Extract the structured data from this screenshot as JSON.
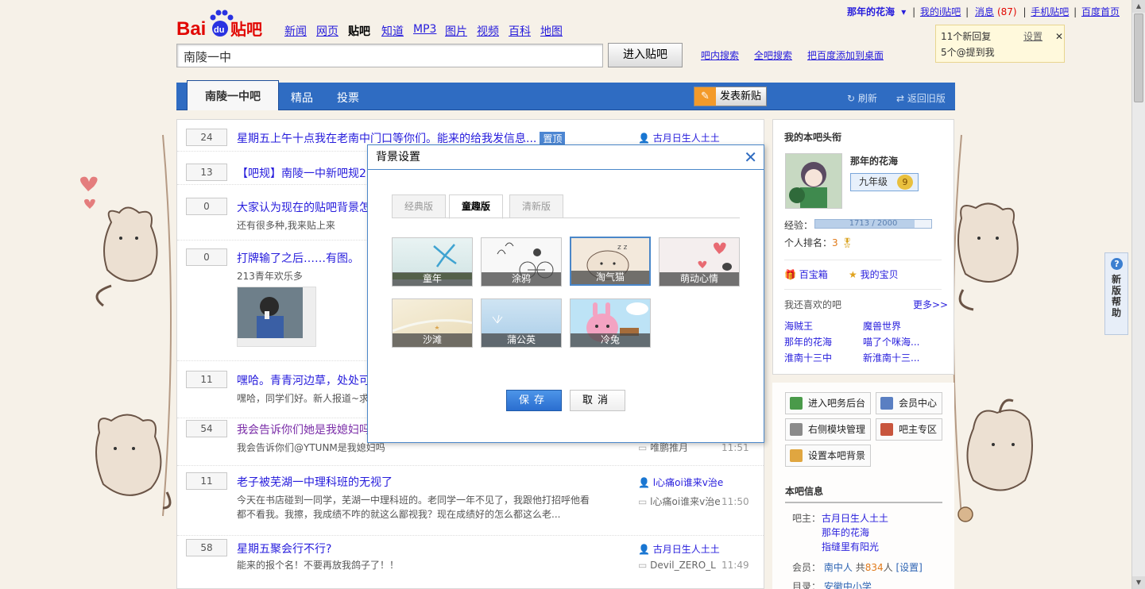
{
  "header": {
    "nav": [
      "新闻",
      "网页",
      "贴吧",
      "知道",
      "MP3",
      "图片",
      "视频",
      "百科",
      "地图"
    ],
    "active_nav": "贴吧",
    "search_value": "南陵一中",
    "enter_button": "进入贴吧",
    "links": [
      "吧内搜索",
      "全吧搜索",
      "把百度添加到桌面"
    ]
  },
  "userbar": {
    "username": "那年的花海",
    "my_i": "我的i贴吧",
    "messages_label": "消息",
    "messages_count": "(87)",
    "mobile": "手机贴吧",
    "home": "百度首页"
  },
  "notif": {
    "line1": "11个新回复",
    "setting": "设置",
    "line2": "5个@提到我"
  },
  "tabbar": {
    "main_tab": "南陵一中吧",
    "tabs": [
      "精品",
      "投票"
    ],
    "post_button": "发表新贴",
    "refresh": "刷新",
    "old_version": "返回旧版"
  },
  "threads": [
    {
      "count": "24",
      "title": "星期五上午十点我在老南中门口等你们。能来的给我发信息...",
      "badge": "置顶",
      "author": "古月日生人土土"
    },
    {
      "count": "13",
      "title": "【吧规】南陵一中新吧规2("
    },
    {
      "count": "0",
      "title": "大家认为现在的贴吧背景怎",
      "abstract": "还有很多种,我来贴上来"
    },
    {
      "count": "0",
      "title": "打牌输了之后……有图。",
      "abstract": "213青年欢乐多"
    },
    {
      "count": "11",
      "title": "嘿哈。青青河边草，处处可",
      "abstract": "嘿哈，同学们好。新人报道~求"
    },
    {
      "count": "54",
      "title": "我会告诉你们她是我媳妇吗",
      "abstract": "我会告诉你们@YTUNM是我媳妇吗",
      "last": "唯鹏推月",
      "time": "11:51"
    },
    {
      "count": "11",
      "title": "老子被芜湖一中理科班的无视了",
      "abstract": "今天在书店碰到一同学，芜湖一中理科班的。老同学一年不见了，我跟他打招呼他看都不看我。我擦，我成绩不咋的就这么鄙视我？现在成绩好的怎么都这么老...",
      "author": "l心痛oi谁来v治e",
      "last": "l心痛oi谁来v治e",
      "time": "11:50"
    },
    {
      "count": "58",
      "title": "星期五聚会行不行?",
      "abstract": "能来的报个名！不要再放我鸽子了！！",
      "author": "古月日生人土土",
      "last": "Devil_ZERO_L",
      "time": "11:49"
    }
  ],
  "sidebar": {
    "title": "我的本吧头衔",
    "username": "那年的花海",
    "level_name": "九年级",
    "level_num": "9",
    "exp_label": "经验：",
    "exp_value": "1713 / 2000",
    "exp_progress": 0.8565,
    "rank_label": "个人排名：",
    "rank_value": "3",
    "treasure": "百宝箱",
    "my_treasure": "我的宝贝",
    "like_title": "我还喜欢的吧",
    "more": "更多>>",
    "liked": [
      "海贼王",
      "魔兽世界",
      "那年的花海",
      "喵了个咪海...",
      "淮南十三中",
      "新淮南十三..."
    ]
  },
  "side2": {
    "buttons": [
      "进入吧务后台",
      "会员中心",
      "右侧模块管理",
      "吧主专区",
      "设置本吧背景"
    ],
    "info_title": "本吧信息",
    "owner_label": "吧主：",
    "owners": [
      "古月日生人土土",
      "那年的花海",
      "指缝里有阳光"
    ],
    "member_label": "会员：",
    "member_name": "南中人",
    "member_count_pre": "共",
    "member_count": "834",
    "member_count_post": "人",
    "member_setting": "[设置]",
    "dir_label": "目录：",
    "dir_value": "安徽中小学"
  },
  "help": {
    "label": "新版帮助",
    "q": "?"
  },
  "modal": {
    "title": "背景设置",
    "tabs": [
      "经典版",
      "童趣版",
      "清新版"
    ],
    "active_tab": "童趣版",
    "thumbs": [
      "童年",
      "涂鸦",
      "淘气猫",
      "萌动心情",
      "沙滩",
      "蒲公英",
      "冷兔"
    ],
    "selected": "淘气猫",
    "save": "保存",
    "cancel": "取消"
  },
  "colors": {
    "accent": "#2f6cc2",
    "link": "#261cdc",
    "badge": "#4c86d2"
  }
}
